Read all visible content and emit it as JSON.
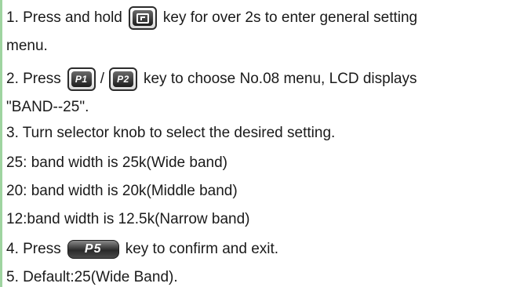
{
  "instructions": {
    "step1_pre": "1. Press and hold",
    "key_f": "F",
    "step1_post": "key for over 2s to enter general setting",
    "step1_cont": "menu.",
    "step2_pre": "2. Press",
    "key_p1": "P1",
    "separator": "/",
    "key_p2": "P2",
    "step2_post": "key to choose No.08 menu, LCD displays",
    "step2_cont": "\"BAND--25\".",
    "step3": "3. Turn selector knob to select the desired setting.",
    "option_25": "25: band width is 25k(Wide band)",
    "option_20": "20: band width is 20k(Middle band)",
    "option_12": "12:band width is 12.5k(Narrow band)",
    "step4_pre": "4. Press",
    "key_p5": "P5",
    "step4_post": "key to confirm and exit.",
    "step5": "5. Default:25(Wide Band)."
  }
}
